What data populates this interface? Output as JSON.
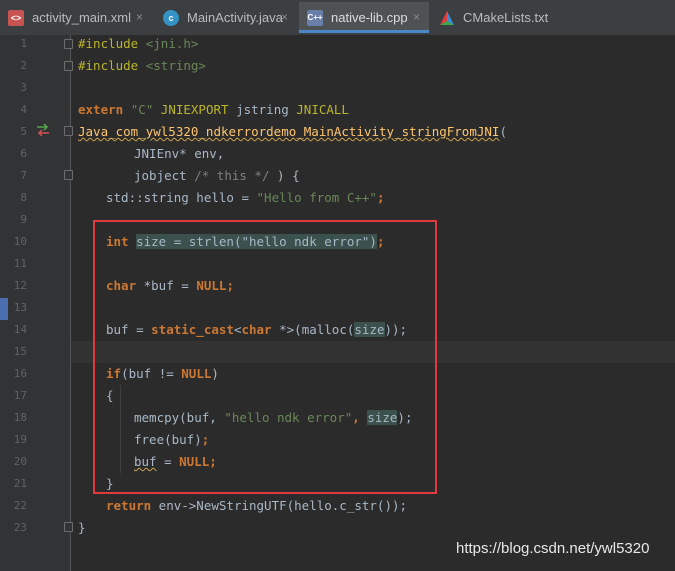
{
  "tabs": [
    {
      "label": "activity_main.xml",
      "icon": "xml-file-icon",
      "close": "×"
    },
    {
      "label": "MainActivity.java",
      "icon": "java-class-icon",
      "close": "×"
    },
    {
      "label": "native-lib.cpp",
      "icon": "cpp-file-icon",
      "close": "×"
    },
    {
      "label": "CMakeLists.txt",
      "icon": "cmake-file-icon",
      "close": ""
    }
  ],
  "line_numbers": [
    "1",
    "2",
    "3",
    "4",
    "5",
    "6",
    "7",
    "8",
    "9",
    "10",
    "11",
    "12",
    "13",
    "14",
    "15",
    "16",
    "17",
    "18",
    "19",
    "20",
    "21",
    "22",
    "23"
  ],
  "code": {
    "l1_directive": "#include",
    "l1_header": "<jni.h>",
    "l2_directive": "#include",
    "l2_header": "<string>",
    "l4_extern": "extern",
    "l4_c": "\"C\"",
    "l4_export": "JNIEXPORT",
    "l4_type": "jstring",
    "l4_call": "JNICALL",
    "l5_name": "Java_com_ywl5320_ndkerrordemo_MainActivity_stringFromJNI",
    "l5_paren": "(",
    "l6": "JNIEnv* env,",
    "l7_a": "jobject ",
    "l7_comment": "/* this */",
    "l7_b": ") {",
    "l8_a": "std::string hello = ",
    "l8_str": "\"Hello from C++\"",
    "l8_b": ";",
    "l10_kw": "int",
    "l10_var": "size = strlen(\"hello ndk error\")",
    "l10_end": ";",
    "l12_kw": "char",
    "l12_a": " *buf = ",
    "l12_null": "NULL",
    "l12_end": ";",
    "l14_a": "buf = ",
    "l14_cast": "static_cast",
    "l14_lt": "<",
    "l14_char": "char",
    "l14_b": " *>(malloc(",
    "l14_size": "size",
    "l14_c": "));",
    "l16_kw": "if",
    "l16_a": "(buf != ",
    "l16_null": "NULL",
    "l16_b": ")",
    "l17": "{",
    "l18_a": "memcpy(buf, ",
    "l18_str": "\"hello ndk error\"",
    "l18_b": ", ",
    "l18_size": "size",
    "l18_c": ");",
    "l19_a": "free(buf)",
    "l19_b": ";",
    "l20_buf": "buf",
    "l20_a": " = ",
    "l20_null": "NULL",
    "l20_b": ";",
    "l21": "}",
    "l22_kw": "return",
    "l22_a": " env->NewStringUTF(hello.c_str());",
    "l23": "}"
  },
  "watermark": "https://blog.csdn.net/ywl5320",
  "colors": {
    "editor_bg": "#2b2b2b",
    "keyword": "#cc7832",
    "string": "#6a8759",
    "macro": "#bbb529",
    "highlight_box": "#e03a3e"
  }
}
